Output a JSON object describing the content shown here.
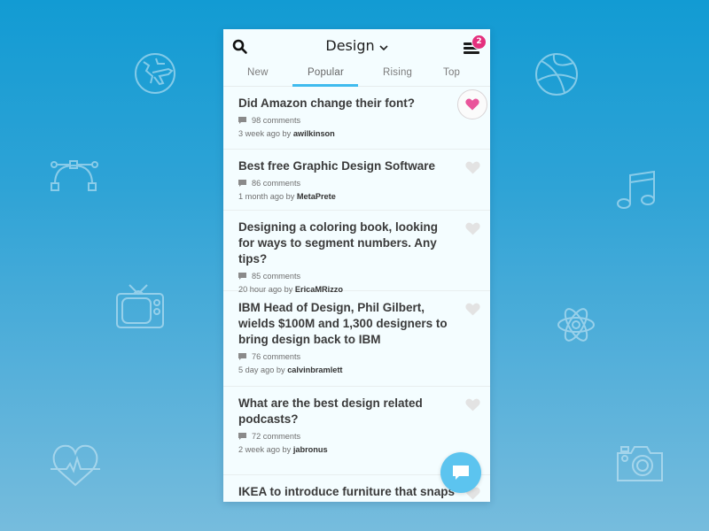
{
  "header": {
    "title": "Design",
    "notification_count": "2"
  },
  "tabs": [
    {
      "label": "New",
      "active": false
    },
    {
      "label": "Popular",
      "active": true
    },
    {
      "label": "Rising",
      "active": false
    },
    {
      "label": "Top",
      "active": false
    }
  ],
  "posts": [
    {
      "title": "Did Amazon change their font?",
      "comments": "98 comments",
      "time": "3 week ago by",
      "author": "awilkinson",
      "liked": true
    },
    {
      "title": "Best free Graphic Design Software",
      "comments": "86 comments",
      "time": "1 month ago by",
      "author": "MetaPrete",
      "liked": false
    },
    {
      "title": "Designing a coloring book, looking for ways to segment numbers. Any tips?",
      "comments": "85 comments",
      "time": "20 hour ago by",
      "author": "EricaMRizzo",
      "liked": false
    },
    {
      "title": "IBM Head of Design, Phil Gilbert, wields $100M and 1,300 designers to bring design back to IBM",
      "comments": "76 comments",
      "time": "5 day ago by",
      "author": "calvinbramlett",
      "liked": false
    },
    {
      "title": "What are the best design related podcasts?",
      "comments": "72 comments",
      "time": "2 week ago by",
      "author": "jabronus",
      "liked": false
    },
    {
      "title": "IKEA to introduce furniture that snaps",
      "comments": "",
      "time": "",
      "author": "",
      "liked": false
    }
  ],
  "colors": {
    "accent": "#3fbbee",
    "badge": "#e4307d",
    "liked_heart": "#e9559b",
    "fab": "#5cc4ef"
  },
  "background_icons": [
    "globe-plane-icon",
    "bezier-curve-icon",
    "tv-icon",
    "heartbeat-icon",
    "basketball-icon",
    "music-note-icon",
    "atom-icon",
    "camera-icon"
  ]
}
